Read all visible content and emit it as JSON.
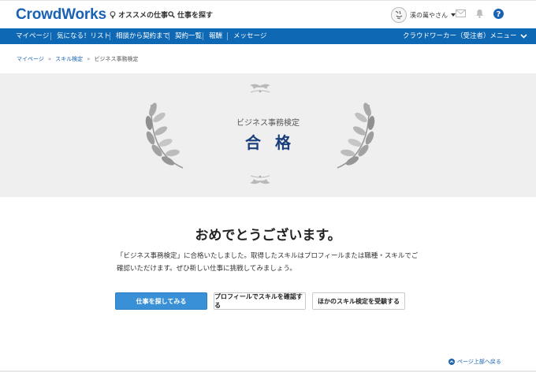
{
  "header": {
    "logo": "CrowdWorks",
    "recommended": "オススメの仕事",
    "search_jobs": "仕事を探す",
    "user_name": "溪の萬やさん"
  },
  "nav": {
    "items": [
      "マイページ",
      "気になる！リスト",
      "相談から契約まで",
      "契約一覧",
      "報酬",
      "メッセージ"
    ],
    "menu": "クラウドワーカー（受注者）メニュー"
  },
  "breadcrumb": {
    "items": [
      "マイページ",
      "スキル検定",
      "ビジネス事務検定"
    ],
    "separator": "»"
  },
  "hero": {
    "subtitle": "ビジネス事務検定",
    "result": "合格"
  },
  "main": {
    "heading": "おめでとうございます。",
    "message": "「ビジネス事務検定」に合格いたしました。取得したスキルはプロフィールまたは職種・スキルでご確認いただけます。ぜひ新しい仕事に挑戦してみましょう。",
    "buttons": {
      "find_jobs": "仕事を探してみる",
      "check_profile": "プロフィールでスキルを確認する",
      "other_tests": "ほかのスキル検定を受験する"
    }
  },
  "footer": {
    "page_top": "ページ上部へ戻る"
  },
  "colors": {
    "brand": "#1a62b4",
    "nav_bg": "#0e68b3",
    "primary_button": "#3a90d6",
    "result_text": "#1a3d7c"
  }
}
